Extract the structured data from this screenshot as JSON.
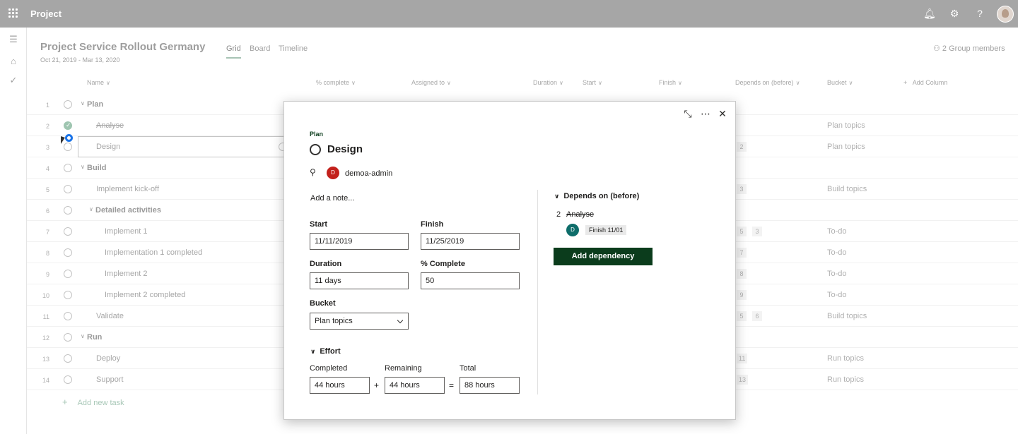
{
  "app": {
    "title": "Project"
  },
  "topbar_icons": [
    "bell-icon",
    "gear-icon",
    "help-icon"
  ],
  "project": {
    "title": "Project Service Rollout Germany",
    "dates": "Oct 21, 2019 - Mar 13, 2020",
    "members": "2 Group members"
  },
  "views": [
    "Grid",
    "Board",
    "Timeline"
  ],
  "columns": {
    "name": "Name",
    "complete": "% complete",
    "assigned": "Assigned to",
    "duration": "Duration",
    "start": "Start",
    "finish": "Finish",
    "depends": "Depends on (before)",
    "bucket": "Bucket",
    "add": "Add Column"
  },
  "rows": [
    {
      "num": "1",
      "name": "Plan",
      "summary": true
    },
    {
      "num": "2",
      "name": "Analyse",
      "done": true,
      "bucket": "Plan topics"
    },
    {
      "num": "3",
      "name": "Design",
      "deps": [
        "2"
      ],
      "bucket": "Plan topics"
    },
    {
      "num": "4",
      "name": "Build",
      "summary": true
    },
    {
      "num": "5",
      "name": "Implement kick-off",
      "deps": [
        "3"
      ],
      "bucket": "Build topics"
    },
    {
      "num": "6",
      "name": "Detailed activities",
      "summary": true
    },
    {
      "num": "7",
      "name": "Implement 1",
      "deps": [
        "5",
        "3"
      ],
      "bucket": "To-do"
    },
    {
      "num": "8",
      "name": "Implementation 1 completed",
      "deps": [
        "7"
      ],
      "bucket": "To-do"
    },
    {
      "num": "9",
      "name": "Implement 2",
      "deps": [
        "8"
      ],
      "bucket": "To-do"
    },
    {
      "num": "10",
      "name": "Implement 2 completed",
      "deps": [
        "9"
      ],
      "bucket": "To-do"
    },
    {
      "num": "11",
      "name": "Validate",
      "deps": [
        "5",
        "6"
      ],
      "bucket": "Build topics"
    },
    {
      "num": "12",
      "name": "Run",
      "summary": true
    },
    {
      "num": "13",
      "name": "Deploy",
      "deps": [
        "11"
      ],
      "bucket": "Run topics"
    },
    {
      "num": "14",
      "name": "Support",
      "deps": [
        "13"
      ],
      "bucket": "Run topics"
    }
  ],
  "add_task": "Add new task",
  "dialog": {
    "breadcrumb": "Plan",
    "title": "Design",
    "avatar_initial": "D",
    "assignee": "demoa-admin",
    "note_placeholder": "Add a note...",
    "start_label": "Start",
    "start_value": "11/11/2019",
    "finish_label": "Finish",
    "finish_value": "11/25/2019",
    "duration_label": "Duration",
    "duration_value": "11 days",
    "complete_label": "% Complete",
    "complete_value": "50",
    "bucket_label": "Bucket",
    "bucket_value": "Plan topics",
    "effort_label": "Effort",
    "completed_label": "Completed",
    "completed_value": "44 hours",
    "remaining_label": "Remaining",
    "remaining_value": "44 hours",
    "total_label": "Total",
    "total_value": "88 hours",
    "plus": "+",
    "equals": "=",
    "deps_label": "Depends on (before)",
    "dep_num": "2",
    "dep_name": "Analyse",
    "dep_avatar": "D",
    "dep_finish": "Finish 11/01",
    "add_dep": "Add dependency"
  }
}
